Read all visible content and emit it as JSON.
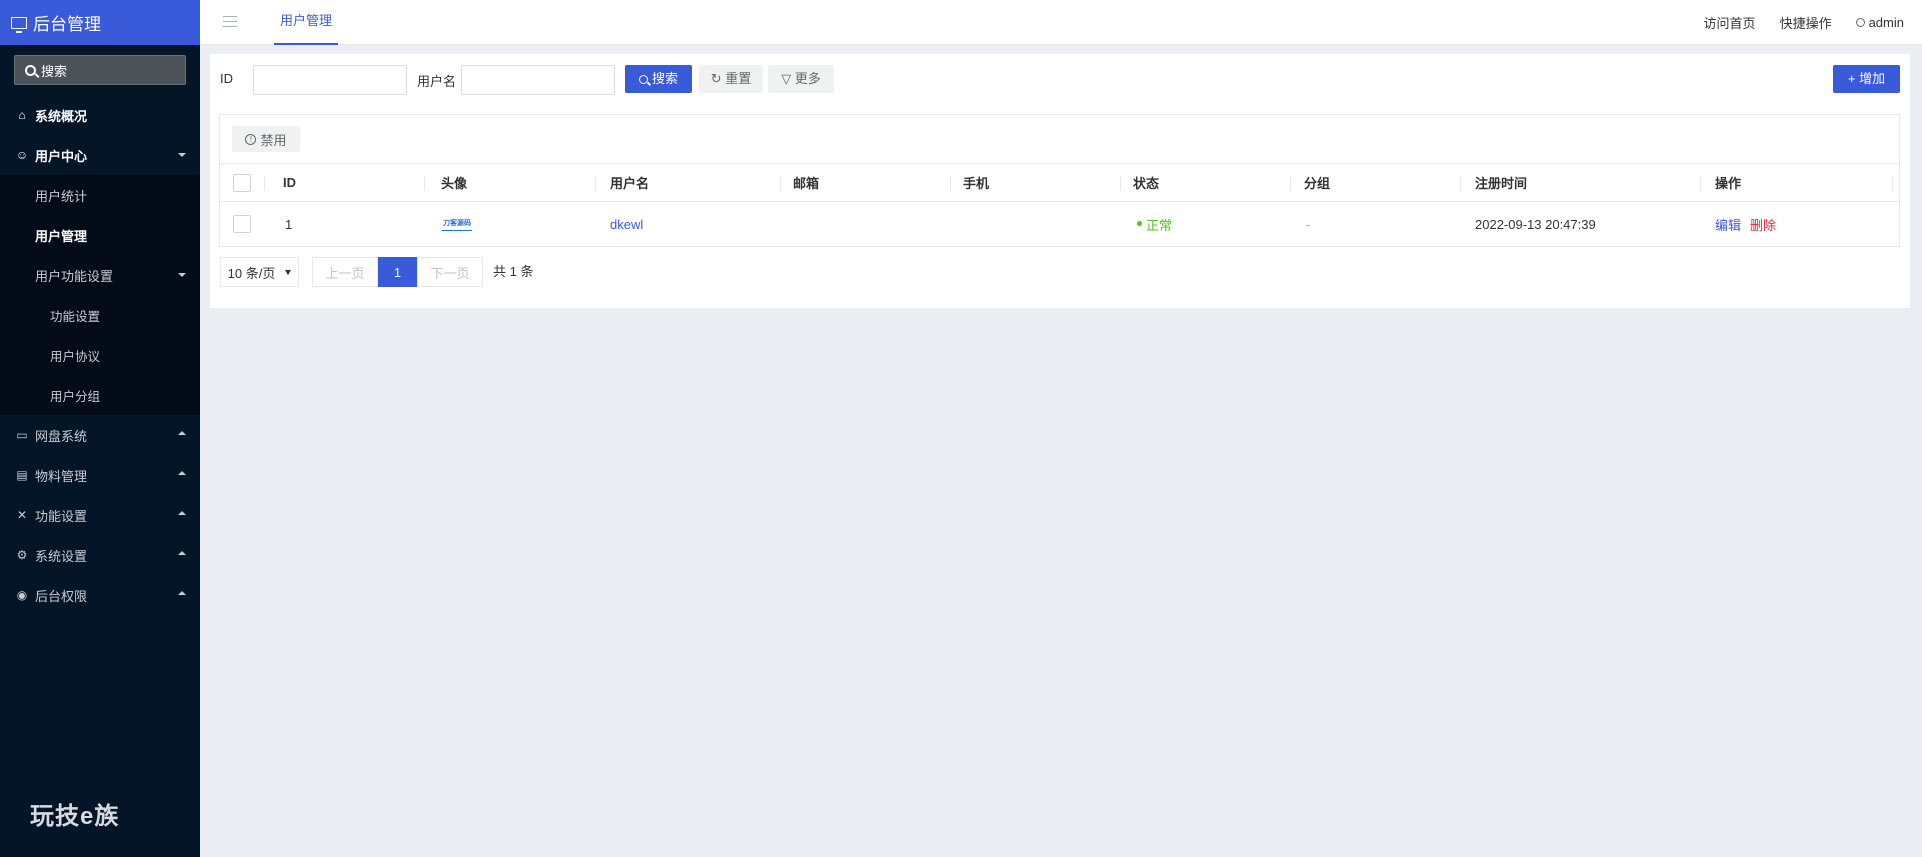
{
  "sidebar": {
    "brand": "后台管理",
    "search_placeholder": "搜索",
    "items": [
      {
        "label": "系统概况",
        "icon": "home-icon"
      },
      {
        "label": "用户中心",
        "icon": "users-icon"
      },
      {
        "label": "用户统计"
      },
      {
        "label": "用户管理"
      },
      {
        "label": "用户功能设置"
      },
      {
        "label": "功能设置"
      },
      {
        "label": "用户协议"
      },
      {
        "label": "用户分组"
      },
      {
        "label": "网盘系统",
        "icon": "folder-icon"
      },
      {
        "label": "物料管理",
        "icon": "document-icon"
      },
      {
        "label": "功能设置",
        "icon": "tools-icon"
      },
      {
        "label": "系统设置",
        "icon": "gear-icon"
      },
      {
        "label": "后台权限",
        "icon": "user-circle-icon"
      }
    ],
    "footer_logo": "玩技e族"
  },
  "header": {
    "active_tab": "用户管理",
    "links": {
      "visit_home": "访问首页",
      "quick_ops": "快捷操作",
      "user": "admin"
    }
  },
  "filters": {
    "id_label": "ID",
    "username_label": "用户名",
    "id_value": "",
    "username_value": "",
    "search_button": "搜索",
    "reset_button": "重置",
    "more_button": "更多",
    "add_button": "增加"
  },
  "toolbar": {
    "disable_button": "禁用"
  },
  "table": {
    "columns": [
      "ID",
      "头像",
      "用户名",
      "邮箱",
      "手机",
      "状态",
      "分组",
      "注册时间",
      "操作"
    ],
    "rows": [
      {
        "id": "1",
        "avatar_text": "刀客源码",
        "username": "dkewl",
        "email": "",
        "phone": "",
        "status": "正常",
        "group": "-",
        "registered": "2022-09-13 20:47:39",
        "edit": "编辑",
        "delete": "删除"
      }
    ]
  },
  "pagination": {
    "page_size": "10 条/页",
    "prev": "上一页",
    "current": "1",
    "next": "下一页",
    "total": "共 1 条"
  },
  "colors": {
    "primary": "#3a5bd9",
    "sidebar_bg": "#041527",
    "success": "#52c41a",
    "danger": "#f5222d"
  }
}
